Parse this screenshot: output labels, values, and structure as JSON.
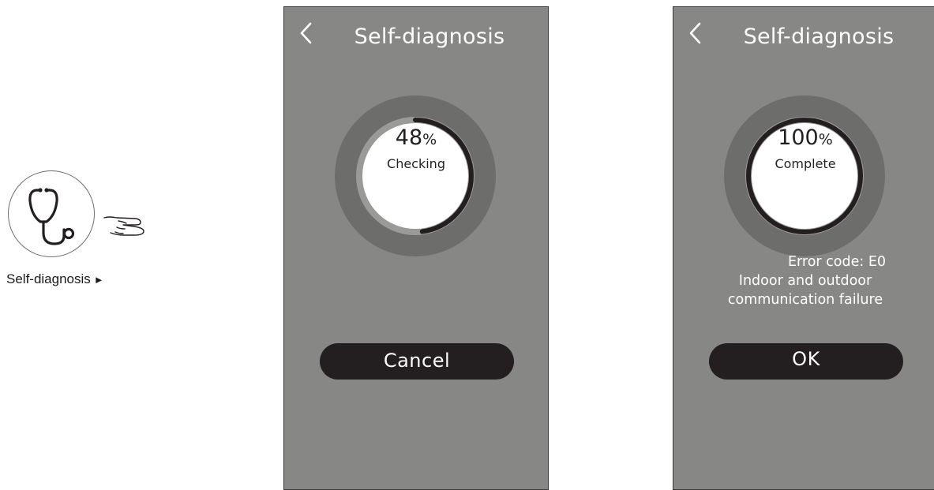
{
  "side": {
    "label": "Self-diagnosis",
    "arrow_glyph": "►",
    "icon": "stethoscope-icon",
    "pointer_icon": "pointing-hand-icon"
  },
  "screens": [
    {
      "back_icon": "chevron-left-icon",
      "title": "Self-diagnosis",
      "progress": {
        "percent_value": "48",
        "unit": "%",
        "fraction": 0.48,
        "status": "Checking"
      },
      "button_label": "Cancel"
    },
    {
      "back_icon": "chevron-left-icon",
      "title": "Self-diagnosis",
      "progress": {
        "percent_value": "100",
        "unit": "%",
        "fraction": 1.0,
        "status": "Complete"
      },
      "error": {
        "code_line": "Error code:  E0",
        "line1": "Indoor and outdoor",
        "line2": "communication failure"
      },
      "button_label": "OK"
    }
  ],
  "colors": {
    "screen_bg": "#878786",
    "outer_ring": "#6d6d6c",
    "inner_ring": "#9a9a99",
    "progress_arc": "#231f20",
    "center": "#ffffff",
    "button_bg": "#231f20"
  }
}
